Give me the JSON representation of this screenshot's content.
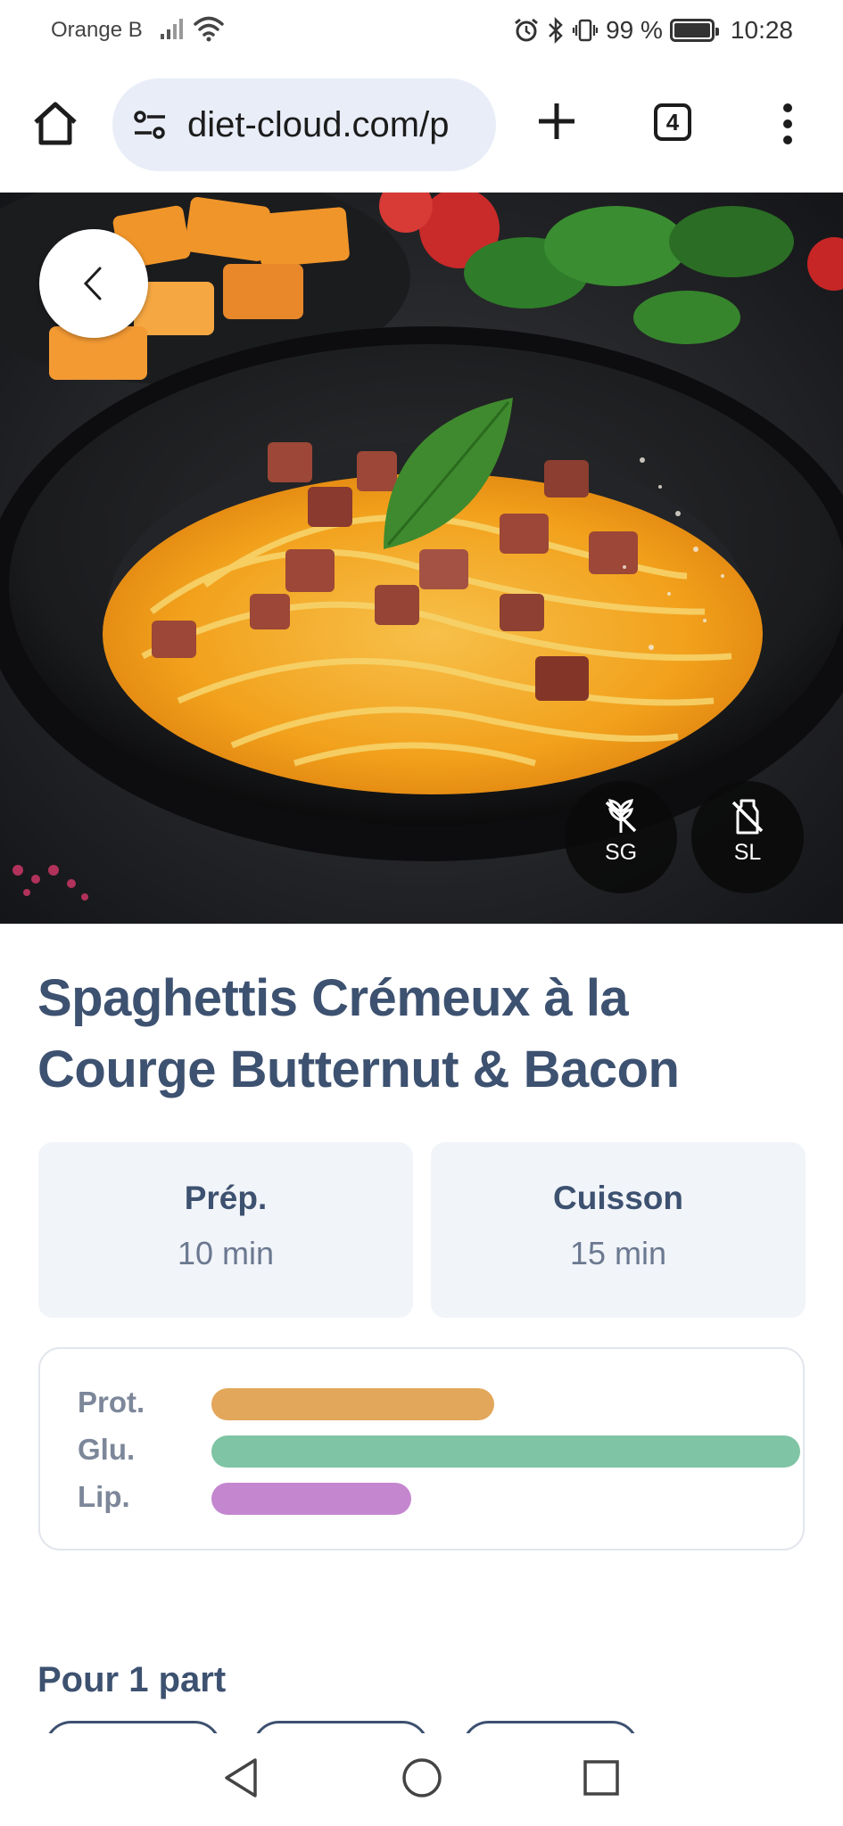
{
  "status_bar": {
    "carrier": "Orange B",
    "battery_percent": "99 %",
    "battery_level": 0.99,
    "time": "10:28"
  },
  "browser": {
    "url": "diet-cloud.com/p",
    "tab_count": "4"
  },
  "recipe": {
    "title": "Spaghettis Crémeux à la Courge Butternut & Bacon",
    "badges": [
      {
        "label": "SG",
        "icon": "gluten-free-icon"
      },
      {
        "label": "SL",
        "icon": "lactose-free-icon"
      }
    ],
    "times": [
      {
        "label": "Prép.",
        "value": "10 min"
      },
      {
        "label": "Cuisson",
        "value": "15 min"
      }
    ],
    "macros": [
      {
        "label": "Prot.",
        "fraction": 0.48,
        "color": "#e2a75a"
      },
      {
        "label": "Glu.",
        "fraction": 1.0,
        "color": "#7fc4a4"
      },
      {
        "label": "Lip.",
        "fraction": 0.34,
        "color": "#c487cf"
      }
    ],
    "portion_label": "Pour 1 part"
  },
  "colors": {
    "title": "#3d5170",
    "card_bg": "#f1f4f8"
  }
}
